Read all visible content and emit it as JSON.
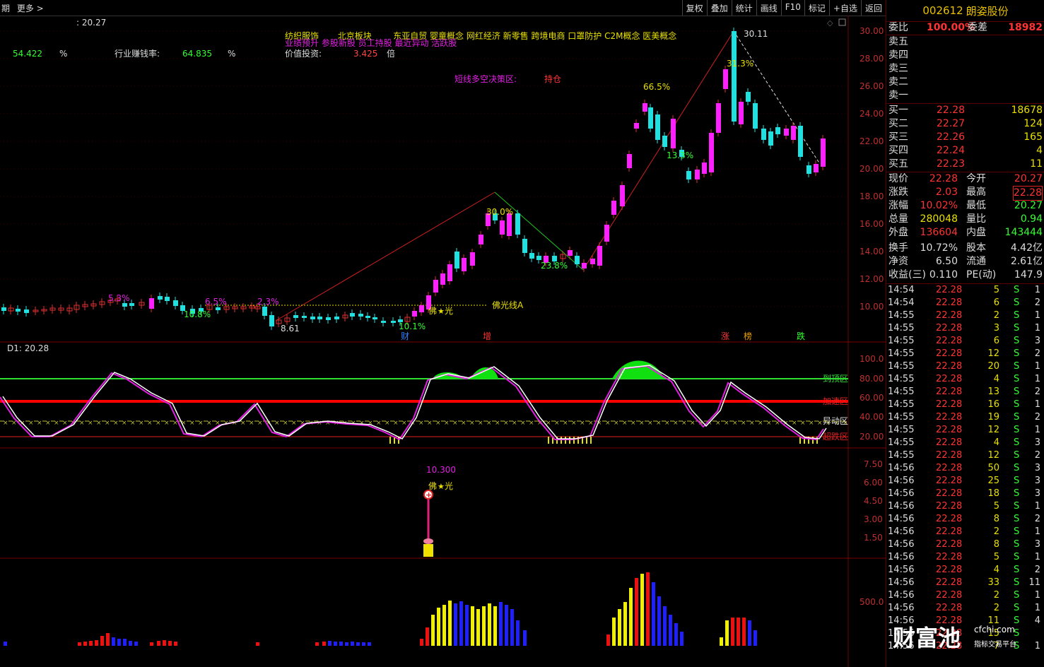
{
  "topbar": {
    "left": [
      "期",
      "更多 >"
    ],
    "buttons": [
      "复权",
      "叠加",
      "统计",
      "画线",
      "F10",
      "标记",
      "+自选",
      "返回"
    ]
  },
  "stock": {
    "code": "002612",
    "name": "朗姿股份"
  },
  "info": {
    "price_tag": ": 20.27",
    "v1": "54.422",
    "pct1": "%",
    "indus_label": "行业赚钱率:",
    "indus_val": "64.835",
    "pct2": "%",
    "concepts1": "纺织服饰       北京板块        东亚自贸 婴童概念 网红经济 新零售 跨境电商 口罩防护 C2M概念 医美概念",
    "concepts2": "业绩预升 参股新股 员工持股 最近异动 活跃股",
    "value_label": "价值投资:",
    "value_val": "3.425",
    "value_unit": "倍",
    "decision_label": "短线多空决策区:",
    "decision_val": "持仓"
  },
  "chart_data": {
    "type": "candlestick",
    "y_axis": [
      "30.00",
      "28.00",
      "26.00",
      "24.00",
      "22.00",
      "20.00",
      "18.00",
      "16.00",
      "14.00",
      "12.00",
      "10.00"
    ],
    "annotations": [
      "30.11",
      "31.3%",
      "66.5%",
      "13.3%",
      "30.0%",
      "23.8%",
      "8.61",
      "10.1%",
      "5.3%",
      "10.8%",
      "6.5%",
      "2.3%",
      "佛光线A",
      "佛光"
    ],
    "markers": [
      "财",
      "增",
      "涨",
      "榜",
      "跌"
    ],
    "ind1_label": "D1: 20.28",
    "ind1_axis": [
      "100.0",
      "80.00",
      "60.00",
      "40.00",
      "20.00"
    ],
    "ind1_zones": [
      "到顶区",
      "加速区",
      "异动区",
      "超跌区"
    ],
    "ind2_axis": [
      "7.50",
      "6.00",
      "4.50",
      "3.00",
      "1.50"
    ],
    "ind2_value": "10.300",
    "ind2_tag": "佛光",
    "vol_axis": [
      "500.0"
    ]
  },
  "quote": {
    "weibi_l": "委比",
    "weibi_v": "100.00%",
    "weicha_l": "委差",
    "weicha_v": "18982",
    "sell": [
      "卖五",
      "卖四",
      "卖三",
      "卖二",
      "卖一"
    ],
    "buy": [
      [
        "买一",
        "22.28",
        "18678"
      ],
      [
        "买二",
        "22.27",
        "124"
      ],
      [
        "买三",
        "22.26",
        "165"
      ],
      [
        "买四",
        "22.24",
        "4"
      ],
      [
        "买五",
        "22.23",
        "11"
      ]
    ],
    "stats": [
      [
        "现价",
        "22.28",
        "今开",
        "20.27"
      ],
      [
        "涨跌",
        "2.03",
        "最高",
        "22.28"
      ],
      [
        "涨幅",
        "10.02%",
        "最低",
        "20.27"
      ],
      [
        "总量",
        "280048",
        "量比",
        "0.94"
      ],
      [
        "外盘",
        "136604",
        "内盘",
        "143444"
      ],
      [
        "换手",
        "10.72%",
        "股本",
        "4.42亿"
      ],
      [
        "净资",
        "6.50",
        "流通",
        "2.61亿"
      ],
      [
        "收益(三)",
        "0.110",
        "PE(动)",
        "147.9"
      ]
    ]
  },
  "ticks": [
    [
      "14:54",
      "22.28",
      "5",
      "S",
      "1"
    ],
    [
      "14:54",
      "22.28",
      "6",
      "S",
      "2"
    ],
    [
      "14:55",
      "22.28",
      "2",
      "S",
      "1"
    ],
    [
      "14:55",
      "22.28",
      "3",
      "S",
      "1"
    ],
    [
      "14:55",
      "22.28",
      "6",
      "S",
      "3"
    ],
    [
      "14:55",
      "22.28",
      "12",
      "S",
      "2"
    ],
    [
      "14:55",
      "22.28",
      "20",
      "S",
      "1"
    ],
    [
      "14:55",
      "22.28",
      "4",
      "S",
      "1"
    ],
    [
      "14:55",
      "22.28",
      "13",
      "S",
      "2"
    ],
    [
      "14:55",
      "22.28",
      "16",
      "S",
      "1"
    ],
    [
      "14:55",
      "22.28",
      "19",
      "S",
      "2"
    ],
    [
      "14:55",
      "22.28",
      "12",
      "S",
      "1"
    ],
    [
      "14:55",
      "22.28",
      "4",
      "S",
      "3"
    ],
    [
      "14:55",
      "22.28",
      "12",
      "S",
      "2"
    ],
    [
      "14:56",
      "22.28",
      "50",
      "S",
      "3"
    ],
    [
      "14:56",
      "22.28",
      "25",
      "S",
      "3"
    ],
    [
      "14:56",
      "22.28",
      "18",
      "S",
      "3"
    ],
    [
      "14:56",
      "22.28",
      "5",
      "S",
      "1"
    ],
    [
      "14:56",
      "22.28",
      "8",
      "S",
      "2"
    ],
    [
      "14:56",
      "22.28",
      "2",
      "S",
      "1"
    ],
    [
      "14:56",
      "22.28",
      "8",
      "S",
      "3"
    ],
    [
      "14:56",
      "22.28",
      "5",
      "S",
      "1"
    ],
    [
      "14:56",
      "22.28",
      "4",
      "S",
      "2"
    ],
    [
      "14:56",
      "22.28",
      "33",
      "S",
      "11"
    ],
    [
      "14:56",
      "22.28",
      "2",
      "S",
      "1"
    ],
    [
      "14:56",
      "22.28",
      "2",
      "S",
      "1"
    ],
    [
      "14:56",
      "22.28",
      "11",
      "S",
      "4"
    ],
    [
      "14:56",
      "22.28",
      "15",
      "S",
      ""
    ],
    [
      "14:56",
      "22.28",
      "7",
      "S",
      "1"
    ]
  ],
  "watermark": {
    "big": "财富池",
    "site": "cfchi.com",
    "sub": "指标交易平台"
  }
}
